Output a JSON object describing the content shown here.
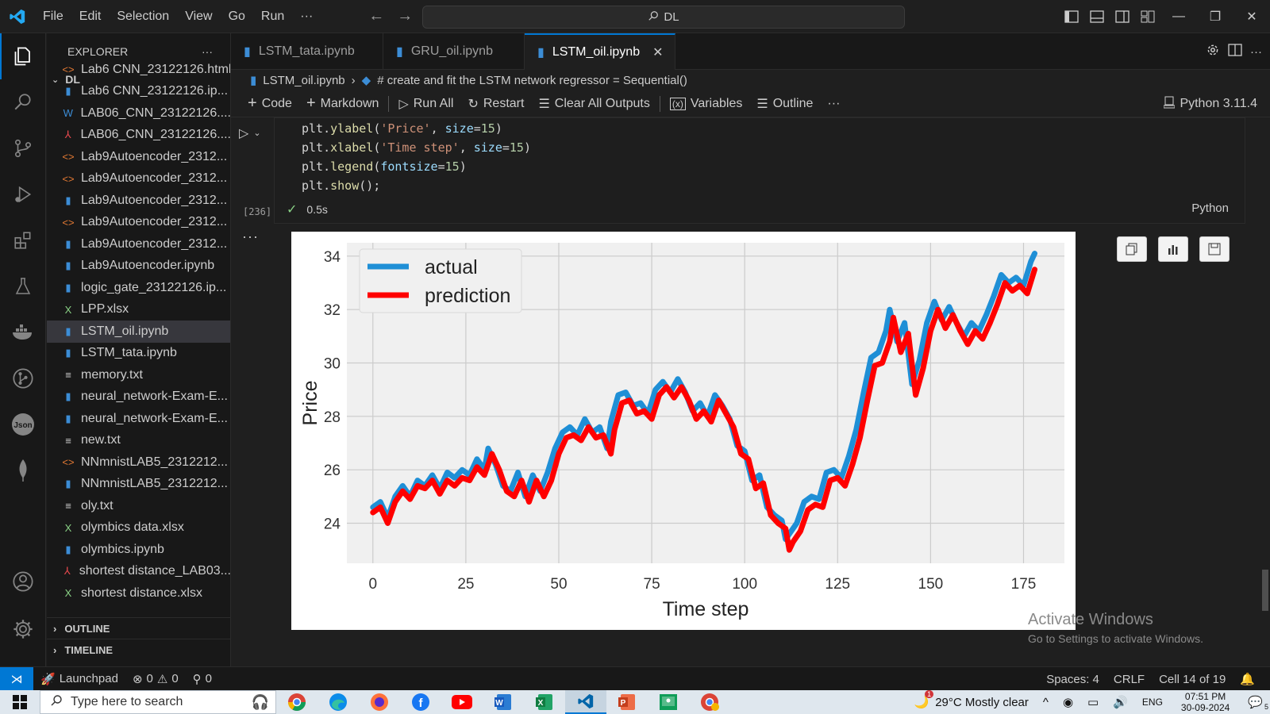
{
  "titlebar": {
    "menus": [
      "File",
      "Edit",
      "Selection",
      "View",
      "Go",
      "Run"
    ],
    "more": "···",
    "command_center": "DL"
  },
  "explorer": {
    "header": "EXPLORER",
    "more": "···",
    "folder": "DL",
    "files": [
      {
        "name": "Lab6 CNN_23122126.html",
        "type": "html"
      },
      {
        "name": "Lab6 CNN_23122126.ip...",
        "type": "ipynb"
      },
      {
        "name": "LAB06_CNN_23122126....",
        "type": "word"
      },
      {
        "name": "LAB06_CNN_23122126....",
        "type": "pdf"
      },
      {
        "name": "Lab9Autoencoder_2312...",
        "type": "html"
      },
      {
        "name": "Lab9Autoencoder_2312...",
        "type": "html"
      },
      {
        "name": "Lab9Autoencoder_2312...",
        "type": "ipynb"
      },
      {
        "name": "Lab9Autoencoder_2312...",
        "type": "html"
      },
      {
        "name": "Lab9Autoencoder_2312...",
        "type": "ipynb"
      },
      {
        "name": "Lab9Autoencoder.ipynb",
        "type": "ipynb"
      },
      {
        "name": "logic_gate_23122126.ip...",
        "type": "ipynb"
      },
      {
        "name": "LPP.xlsx",
        "type": "excel"
      },
      {
        "name": "LSTM_oil.ipynb",
        "type": "ipynb",
        "selected": true
      },
      {
        "name": "LSTM_tata.ipynb",
        "type": "ipynb"
      },
      {
        "name": "memory.txt",
        "type": "txt"
      },
      {
        "name": "neural_network-Exam-E...",
        "type": "ipynb"
      },
      {
        "name": "neural_network-Exam-E...",
        "type": "ipynb"
      },
      {
        "name": "new.txt",
        "type": "txt"
      },
      {
        "name": "NNmnistLAB5_2312212...",
        "type": "html"
      },
      {
        "name": "NNmnistLAB5_2312212...",
        "type": "ipynb"
      },
      {
        "name": "oly.txt",
        "type": "txt"
      },
      {
        "name": "olymbics data.xlsx",
        "type": "excel"
      },
      {
        "name": "olymbics.ipynb",
        "type": "ipynb"
      },
      {
        "name": "shortest distance_LAB03...",
        "type": "pdf"
      },
      {
        "name": "shortest distance.xlsx",
        "type": "excel"
      }
    ],
    "outline": "OUTLINE",
    "timeline": "TIMELINE"
  },
  "tabs": [
    {
      "label": "LSTM_tata.ipynb",
      "active": false
    },
    {
      "label": "GRU_oil.ipynb",
      "active": false
    },
    {
      "label": "LSTM_oil.ipynb",
      "active": true
    }
  ],
  "breadcrumb": {
    "file": "LSTM_oil.ipynb",
    "cell": "# create and fit the LSTM network regressor = Sequential()"
  },
  "toolbar": {
    "code": "Code",
    "markdown": "Markdown",
    "run_all": "Run All",
    "restart": "Restart",
    "clear": "Clear All Outputs",
    "variables": "Variables",
    "outline": "Outline",
    "more": "···",
    "kernel": "Python 3.11.4"
  },
  "cell": {
    "code_lines": [
      [
        "plt.",
        "ylabel",
        "(",
        "'Price'",
        ", ",
        "size",
        "=",
        "15",
        ")"
      ],
      [
        "plt.",
        "xlabel",
        "(",
        "'Time step'",
        ", ",
        "size",
        "=",
        "15",
        ")"
      ],
      [
        "plt.",
        "legend",
        "(",
        "",
        "",
        "fontsize",
        "=",
        "15",
        ")"
      ],
      [
        "plt.",
        "show",
        "();",
        "",
        "",
        "",
        "",
        "",
        ""
      ]
    ],
    "exec_count": "[236]",
    "exec_time": "0.5s",
    "language": "Python",
    "output_more": "···"
  },
  "chart_data": {
    "type": "line",
    "xlabel": "Time step",
    "ylabel": "Price",
    "xlim": [
      -7,
      186
    ],
    "ylim": [
      22.5,
      34.5
    ],
    "xticks": [
      0,
      25,
      50,
      75,
      100,
      125,
      150,
      175
    ],
    "yticks": [
      24,
      26,
      28,
      30,
      32,
      34
    ],
    "grid": true,
    "legend_position": "top-left",
    "series": [
      {
        "name": "actual",
        "color": "#1f8fd6",
        "points": [
          [
            0,
            24.6
          ],
          [
            2,
            24.8
          ],
          [
            4,
            24.2
          ],
          [
            6,
            25.0
          ],
          [
            8,
            25.4
          ],
          [
            10,
            25.0
          ],
          [
            12,
            25.6
          ],
          [
            14,
            25.4
          ],
          [
            16,
            25.8
          ],
          [
            18,
            25.3
          ],
          [
            20,
            25.9
          ],
          [
            22,
            25.7
          ],
          [
            24,
            26.0
          ],
          [
            26,
            25.8
          ],
          [
            28,
            26.4
          ],
          [
            30,
            26.0
          ],
          [
            31,
            26.8
          ],
          [
            33,
            26.2
          ],
          [
            35,
            25.4
          ],
          [
            37,
            25.2
          ],
          [
            39,
            25.9
          ],
          [
            41,
            25.0
          ],
          [
            43,
            25.8
          ],
          [
            45,
            25.2
          ],
          [
            47,
            25.9
          ],
          [
            49,
            26.8
          ],
          [
            51,
            27.4
          ],
          [
            53,
            27.6
          ],
          [
            55,
            27.3
          ],
          [
            57,
            27.9
          ],
          [
            59,
            27.4
          ],
          [
            61,
            27.6
          ],
          [
            63,
            26.8
          ],
          [
            64,
            27.8
          ],
          [
            66,
            28.8
          ],
          [
            68,
            28.9
          ],
          [
            70,
            28.4
          ],
          [
            72,
            28.5
          ],
          [
            74,
            28.1
          ],
          [
            76,
            29.0
          ],
          [
            78,
            29.3
          ],
          [
            80,
            28.9
          ],
          [
            82,
            29.4
          ],
          [
            84,
            28.9
          ],
          [
            86,
            28.2
          ],
          [
            88,
            28.5
          ],
          [
            90,
            28.0
          ],
          [
            92,
            28.8
          ],
          [
            94,
            28.4
          ],
          [
            96,
            27.9
          ],
          [
            98,
            26.9
          ],
          [
            100,
            26.7
          ],
          [
            102,
            25.6
          ],
          [
            104,
            25.8
          ],
          [
            106,
            24.6
          ],
          [
            108,
            24.3
          ],
          [
            110,
            24.1
          ],
          [
            111,
            23.4
          ],
          [
            112,
            23.6
          ],
          [
            114,
            24.0
          ],
          [
            116,
            24.8
          ],
          [
            118,
            25.0
          ],
          [
            120,
            24.9
          ],
          [
            122,
            25.9
          ],
          [
            124,
            26.0
          ],
          [
            126,
            25.7
          ],
          [
            128,
            26.5
          ],
          [
            130,
            27.5
          ],
          [
            132,
            28.9
          ],
          [
            134,
            30.2
          ],
          [
            136,
            30.4
          ],
          [
            138,
            31.2
          ],
          [
            139,
            32.0
          ],
          [
            141,
            30.8
          ],
          [
            143,
            31.5
          ],
          [
            145,
            29.2
          ],
          [
            147,
            30.1
          ],
          [
            149,
            31.5
          ],
          [
            151,
            32.3
          ],
          [
            153,
            31.6
          ],
          [
            155,
            32.1
          ],
          [
            157,
            31.5
          ],
          [
            159,
            31.0
          ],
          [
            161,
            31.5
          ],
          [
            163,
            31.2
          ],
          [
            165,
            31.8
          ],
          [
            167,
            32.5
          ],
          [
            169,
            33.3
          ],
          [
            171,
            33.0
          ],
          [
            173,
            33.2
          ],
          [
            175,
            32.9
          ],
          [
            177,
            33.8
          ],
          [
            178,
            34.1
          ]
        ]
      },
      {
        "name": "prediction",
        "color": "#ff0000",
        "points": [
          [
            0,
            24.4
          ],
          [
            2,
            24.6
          ],
          [
            4,
            24.0
          ],
          [
            6,
            24.8
          ],
          [
            8,
            25.2
          ],
          [
            10,
            24.9
          ],
          [
            12,
            25.4
          ],
          [
            14,
            25.3
          ],
          [
            16,
            25.6
          ],
          [
            18,
            25.1
          ],
          [
            20,
            25.6
          ],
          [
            22,
            25.4
          ],
          [
            24,
            25.7
          ],
          [
            26,
            25.6
          ],
          [
            28,
            26.1
          ],
          [
            30,
            25.8
          ],
          [
            32,
            26.6
          ],
          [
            34,
            26.0
          ],
          [
            36,
            25.2
          ],
          [
            38,
            25.0
          ],
          [
            40,
            25.6
          ],
          [
            42,
            24.8
          ],
          [
            44,
            25.6
          ],
          [
            46,
            25.0
          ],
          [
            48,
            25.6
          ],
          [
            50,
            26.6
          ],
          [
            52,
            27.2
          ],
          [
            54,
            27.3
          ],
          [
            56,
            27.1
          ],
          [
            58,
            27.6
          ],
          [
            60,
            27.2
          ],
          [
            62,
            27.3
          ],
          [
            64,
            26.6
          ],
          [
            65,
            27.5
          ],
          [
            67,
            28.5
          ],
          [
            69,
            28.6
          ],
          [
            71,
            28.1
          ],
          [
            73,
            28.2
          ],
          [
            75,
            27.9
          ],
          [
            77,
            28.8
          ],
          [
            79,
            29.1
          ],
          [
            81,
            28.7
          ],
          [
            83,
            29.1
          ],
          [
            85,
            28.6
          ],
          [
            87,
            27.9
          ],
          [
            89,
            28.2
          ],
          [
            91,
            27.8
          ],
          [
            93,
            28.6
          ],
          [
            95,
            28.1
          ],
          [
            97,
            27.6
          ],
          [
            99,
            26.6
          ],
          [
            101,
            26.4
          ],
          [
            103,
            25.3
          ],
          [
            105,
            25.5
          ],
          [
            107,
            24.3
          ],
          [
            109,
            24.0
          ],
          [
            111,
            23.8
          ],
          [
            112,
            23.0
          ],
          [
            113,
            23.3
          ],
          [
            115,
            23.7
          ],
          [
            117,
            24.5
          ],
          [
            119,
            24.7
          ],
          [
            121,
            24.6
          ],
          [
            123,
            25.6
          ],
          [
            125,
            25.7
          ],
          [
            127,
            25.4
          ],
          [
            129,
            26.2
          ],
          [
            131,
            27.2
          ],
          [
            133,
            28.6
          ],
          [
            135,
            29.9
          ],
          [
            137,
            30.0
          ],
          [
            139,
            30.8
          ],
          [
            140,
            31.7
          ],
          [
            142,
            30.4
          ],
          [
            144,
            31.1
          ],
          [
            146,
            28.8
          ],
          [
            148,
            29.8
          ],
          [
            150,
            31.2
          ],
          [
            152,
            32.0
          ],
          [
            154,
            31.3
          ],
          [
            156,
            31.8
          ],
          [
            158,
            31.2
          ],
          [
            160,
            30.7
          ],
          [
            162,
            31.2
          ],
          [
            164,
            30.9
          ],
          [
            166,
            31.5
          ],
          [
            168,
            32.2
          ],
          [
            170,
            33.0
          ],
          [
            172,
            32.7
          ],
          [
            174,
            32.9
          ],
          [
            176,
            32.6
          ],
          [
            178,
            33.5
          ]
        ]
      }
    ]
  },
  "watermark": {
    "title": "Activate Windows",
    "subtitle": "Go to Settings to activate Windows."
  },
  "statusbar": {
    "launchpad": "Launchpad",
    "errors": "0",
    "warnings": "0",
    "ports": "0",
    "spaces": "Spaces: 4",
    "eol": "CRLF",
    "cell_pos": "Cell 14 of 19"
  },
  "taskbar": {
    "search_placeholder": "Type here to search",
    "weather": "29°C  Mostly clear",
    "lang": "ENG",
    "time": "07:51 PM",
    "date": "30-09-2024",
    "notif_count": "5",
    "weather_badge": "1"
  }
}
